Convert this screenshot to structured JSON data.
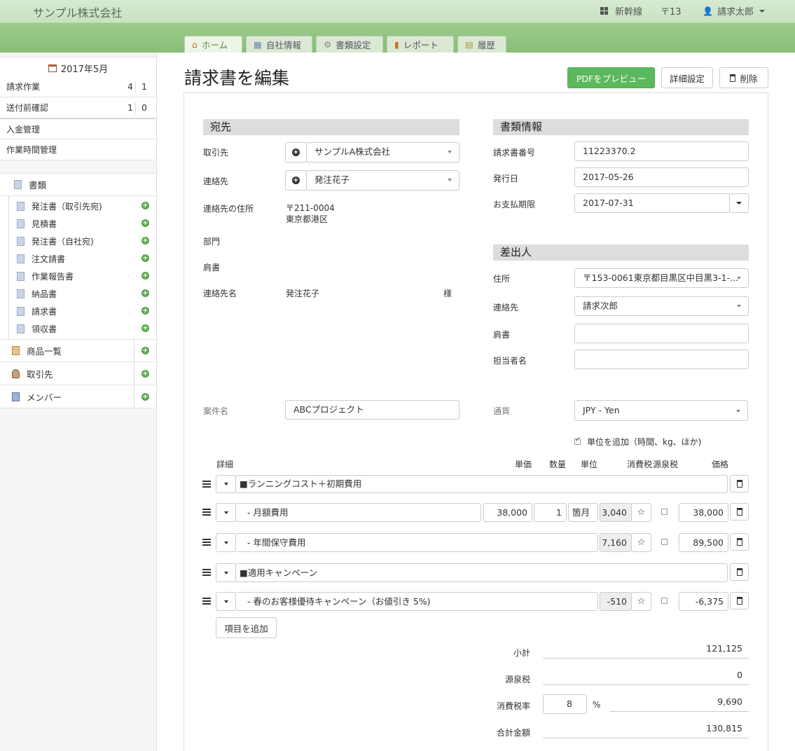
{
  "header": {
    "company": "サンプル株式会社",
    "nav": [
      {
        "label": "新幹線",
        "icon": "grid-icon"
      },
      {
        "label": "〒13",
        "icon": "postal-icon"
      },
      {
        "label": "請求太郎",
        "icon": "user-icon"
      }
    ]
  },
  "tabs": [
    {
      "label": "ホーム",
      "icon": "home-icon"
    },
    {
      "label": "自社情報",
      "icon": "building-icon"
    },
    {
      "label": "書類設定",
      "icon": "gear-icon"
    },
    {
      "label": "レポート",
      "icon": "chart-icon"
    },
    {
      "label": "履歴",
      "icon": "history-icon"
    }
  ],
  "sidebar": {
    "month": "2017年5月",
    "counts": [
      {
        "label": "請求作業",
        "a": "4",
        "b": "1"
      },
      {
        "label": "送付前確認",
        "a": "1",
        "b": "0"
      }
    ],
    "links": [
      "入金管理",
      "作業時間管理"
    ],
    "docs_header": "書類",
    "docs": [
      "発注書（取引先宛)",
      "見積書",
      "発注書（自社宛)",
      "注文請書",
      "作業報告書",
      "納品書",
      "請求書",
      "領収書"
    ],
    "bottom": [
      "商品一覧",
      "取引先",
      "メンバー"
    ]
  },
  "page": {
    "title": "請求書を編集",
    "buttons": {
      "preview": "PDFをプレビュー",
      "settings": "詳細設定",
      "delete": "削除"
    }
  },
  "recipient": {
    "heading": "宛先",
    "client_label": "取引先",
    "client": "サンプルA株式会社",
    "contact_label": "連絡先",
    "contact": "発注花子",
    "address_label": "連絡先の住所",
    "postal": "〒211-0004",
    "address": "東京都港区",
    "dept_label": "部門",
    "title_label": "肩書",
    "contact_name_label": "連絡先名",
    "contact_name": "発注花子",
    "honorific": "様"
  },
  "docinfo": {
    "heading": "書類情報",
    "number_label": "請求書番号",
    "number": "11223370.2",
    "issue_label": "発行日",
    "issue": "2017-05-26",
    "due_label": "お支払期限",
    "due": "2017-07-31"
  },
  "sender": {
    "heading": "差出人",
    "address_label": "住所",
    "address": "〒153-0061東京都目黒区中目黒3-1-...",
    "contact_label": "連絡先",
    "contact": "請求次郎",
    "title_label": "肩書",
    "title": "",
    "person_label": "担当者名",
    "person": ""
  },
  "project": {
    "label": "案件名",
    "value": "ABCプロジェクト",
    "currency_label": "通貨",
    "currency": "JPY - Yen",
    "unit_check": "単位を追加（時間、kg、ほか)"
  },
  "columns": {
    "detail": "詳細",
    "unit_price": "単価",
    "qty": "数量",
    "unit": "単位",
    "tax": "消費税",
    "withholding": "源泉税",
    "price": "価格"
  },
  "lines": [
    {
      "desc": "■ランニングコスト＋初期費用"
    },
    {
      "desc": "- 月額費用",
      "unit_price": "38,000",
      "qty": "1",
      "unit": "箇月",
      "tax": "3,040",
      "price": "38,000"
    },
    {
      "desc": "- 年間保守費用",
      "tax": "7,160",
      "price": "89,500"
    },
    {
      "desc": "■適用キャンペーン"
    },
    {
      "desc": "- 春のお客様優待キャンペーン（お値引き 5%)",
      "tax": "-510",
      "price": "-6,375"
    }
  ],
  "add_item": "項目を追加",
  "totals": {
    "subtotal_label": "小計",
    "subtotal": "121,125",
    "withholding_label": "源泉税",
    "withholding": "0",
    "taxrate_label": "消費税率",
    "taxrate": "8",
    "pct": "%",
    "tax": "9,690",
    "total_label": "合計金額",
    "total": "130,815"
  }
}
